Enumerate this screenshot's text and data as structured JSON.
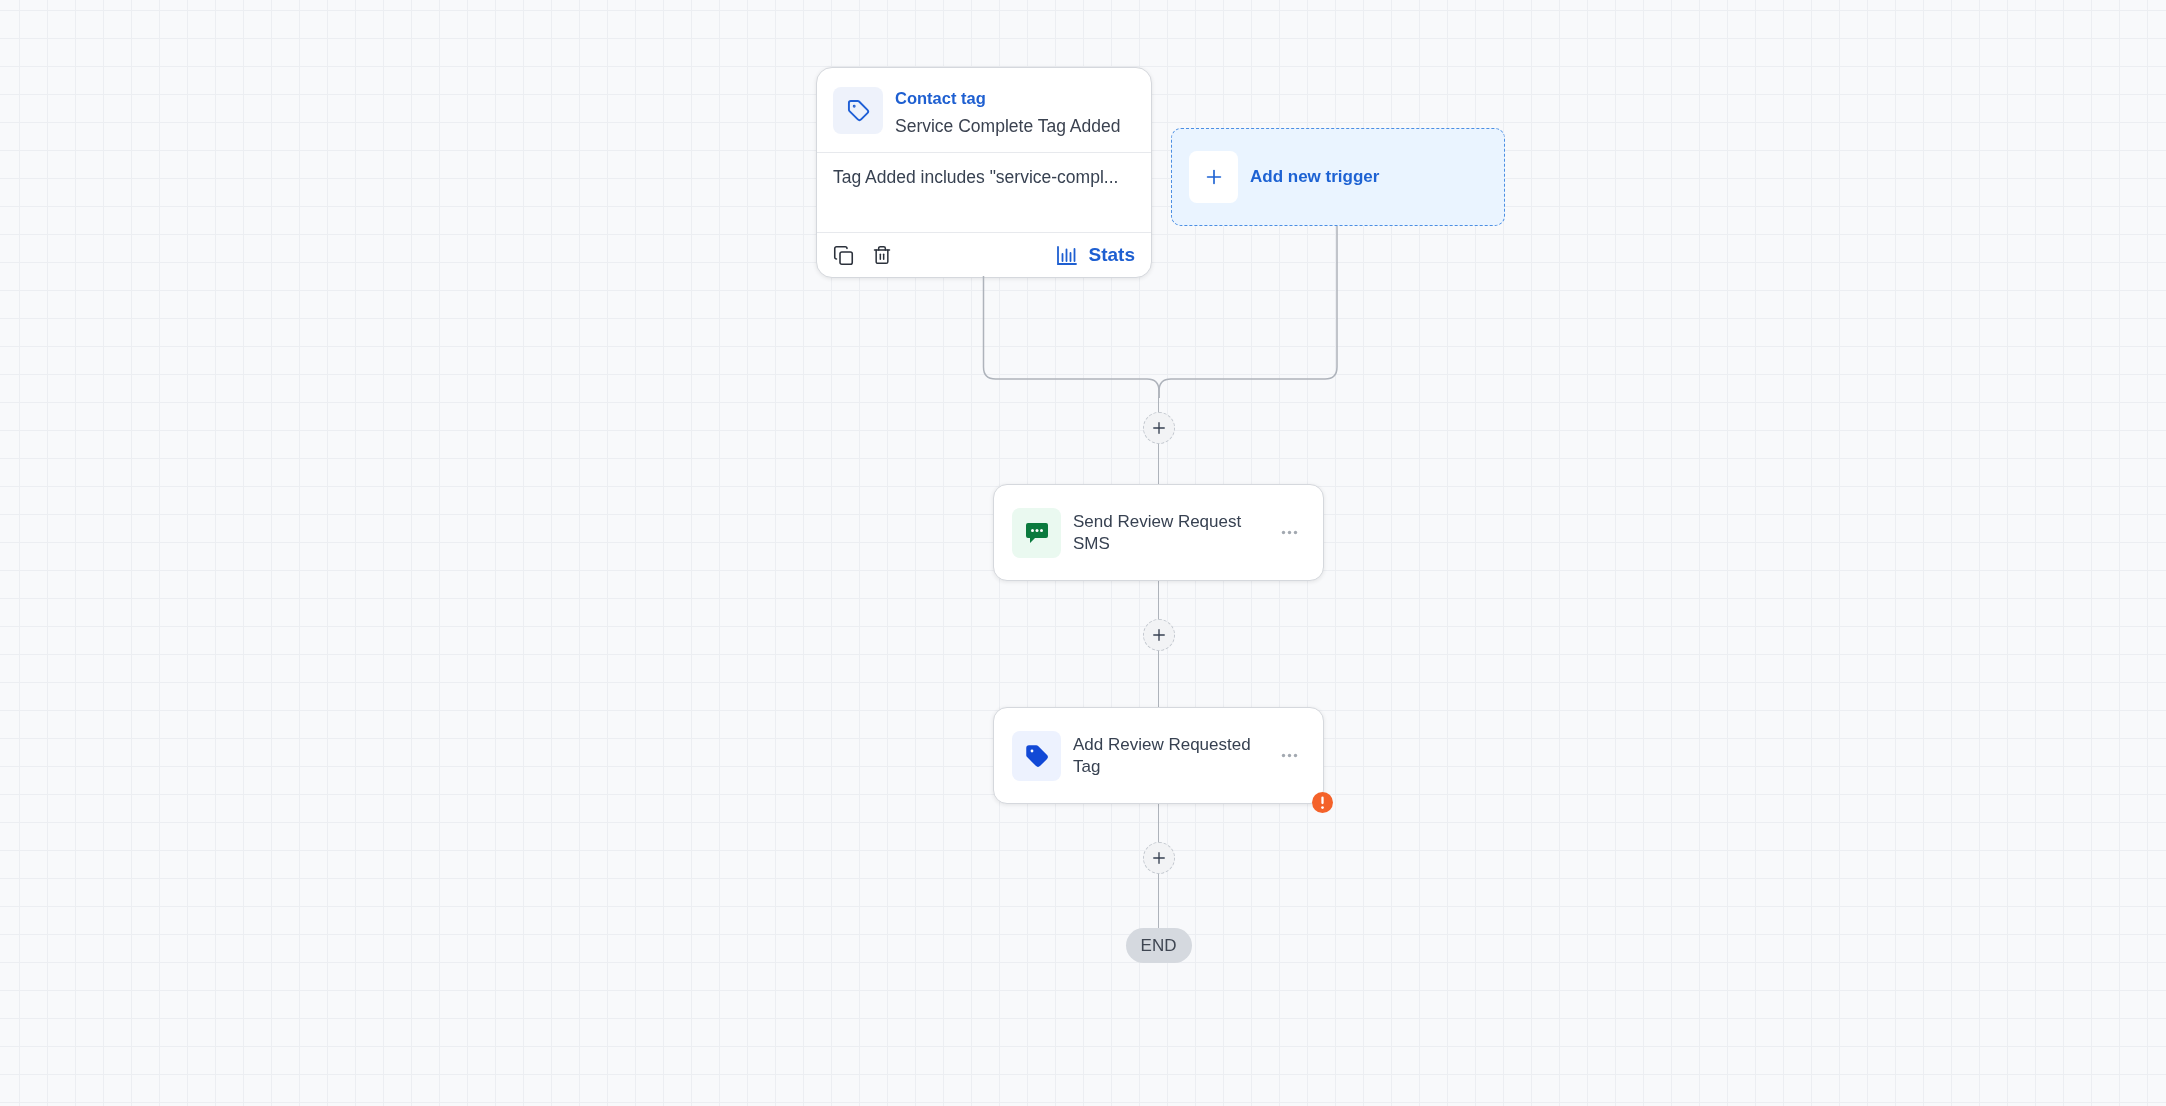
{
  "trigger": {
    "title": "Contact tag",
    "subtitle": "Service Complete Tag Added",
    "condition": "Tag Added includes \"service-compl...",
    "stats_label": "Stats"
  },
  "add_trigger": {
    "label": "Add new trigger"
  },
  "actions": [
    {
      "kind": "sms",
      "title": "Send Review Request SMS",
      "warning": false
    },
    {
      "kind": "tag",
      "title": "Add Review Requested Tag",
      "warning": true
    }
  ],
  "end": {
    "label": "END"
  }
}
